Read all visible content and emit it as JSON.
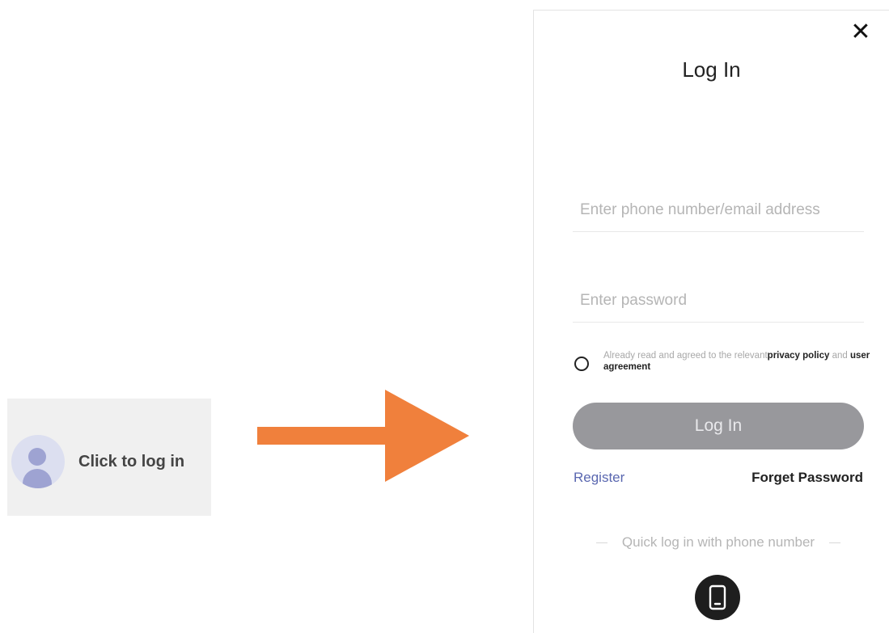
{
  "prompt_card": {
    "label": "Click to log in"
  },
  "modal": {
    "title": "Log In",
    "close_icon": "close-icon",
    "phone_input": {
      "value": "",
      "placeholder": "Enter phone number/email address"
    },
    "password_input": {
      "value": "",
      "placeholder": "Enter password"
    },
    "agreement": {
      "prefix": "Already read and agreed to the relevant",
      "privacy_policy": "privacy policy",
      "conjunction": "and",
      "user_agreement": "user agreement"
    },
    "login_button": "Log In",
    "register_link": "Register",
    "forget_link": "Forget Password",
    "quick_login_label": "Quick log in with phone number",
    "phone_icon": "mobile-phone-icon"
  },
  "colors": {
    "arrow": "#f0803c",
    "login_button_bg": "#98989c",
    "register_link": "#5a67b0",
    "avatar_bg": "#dcdff0",
    "avatar_figure": "#9ea3d2"
  }
}
